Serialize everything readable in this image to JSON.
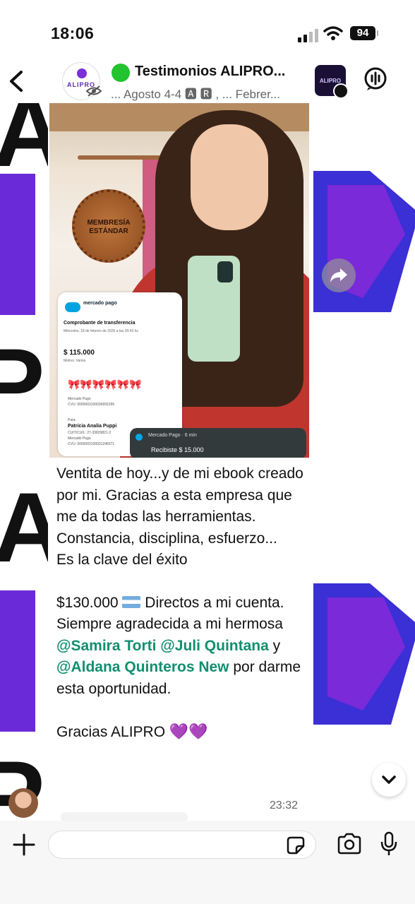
{
  "status_bar": {
    "time": "18:06",
    "battery": "94"
  },
  "header": {
    "group_name": "Testimonios ALIPRO...",
    "subtitle": "... Agosto 4-4 🅰 🆁 , ... Febrer...",
    "avatar_text": "ALIPRO",
    "channel_avatar_text": "ALIPRO"
  },
  "background": {
    "row1": "ALI",
    "row2": "PRO",
    "row3": "ALI",
    "row4": "PRO"
  },
  "photo": {
    "badge_text": "MEMBRESÍA ESTÁNDAR",
    "receipt": {
      "brand": "mercado pago",
      "title": "Comprobante de transferencia",
      "date": "Miércoles, 18 de febrero de 2026 a las 20:43 hs",
      "amount": "$ 115.000",
      "motivo": "Motivo: Varios",
      "bows": "🎀🎀🎀🎀🎀🎀",
      "line1": "Mercado Pago",
      "line2": "CVU: 0000003100036655295",
      "para": "Para",
      "payee": "Patricia Analia Puppi",
      "payee_line1": "CUIT/CUIL: 27-33829821-3",
      "payee_line2": "Mercado Pago",
      "payee_line3": "CVU: 0000003100031246571"
    },
    "notification": {
      "source": "Mercado Pago · 6 min",
      "text": "Recibiste $ 15.000"
    }
  },
  "message": {
    "line1": "Ventita de hoy...y de mi ebook creado por mi. Gracias a esta empresa que me da todas las herramientas.",
    "line2": "Constancia, disciplina, esfuerzo...",
    "line3": "Es la clave del éxito",
    "amount": "$130.000",
    "after_flag": " Directos a mi cuenta. Siempre agradecida a mi hermosa ",
    "mention1": "@Samira Torti",
    "mention2": "@Juli Quintana",
    "between": " y ",
    "mention3": "@Aldana Quinteros New",
    "ending": " por darme esta oportunidad.",
    "thanks": "Gracias ALIPRO ",
    "hearts": "💜💜",
    "time": "23:32"
  },
  "colors": {
    "mention": "#118f70",
    "online": "#22c32e",
    "brand_purple": "#7b2fd6"
  }
}
